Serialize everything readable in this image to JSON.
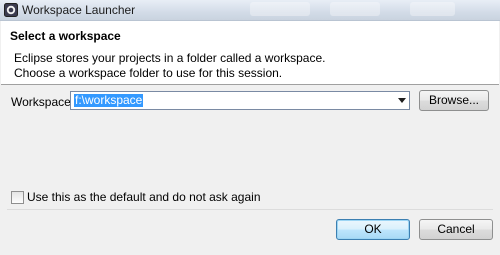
{
  "window": {
    "title": "Workspace Launcher"
  },
  "header": {
    "title": "Select a workspace",
    "description_line1": "Eclipse stores your projects in a folder called a workspace.",
    "description_line2": "Choose a workspace folder to use for this session."
  },
  "workspace": {
    "label": "Workspace:",
    "value": "f:\\workspace",
    "browse_label": "Browse..."
  },
  "options": {
    "default_checkbox_label": "Use this as the default and do not ask again",
    "default_checked": false
  },
  "buttons": {
    "ok_label": "OK",
    "cancel_label": "Cancel"
  },
  "colors": {
    "selection": "#3399ff",
    "dialog_bg": "#f0f0f0",
    "header_bg": "#ffffff"
  }
}
